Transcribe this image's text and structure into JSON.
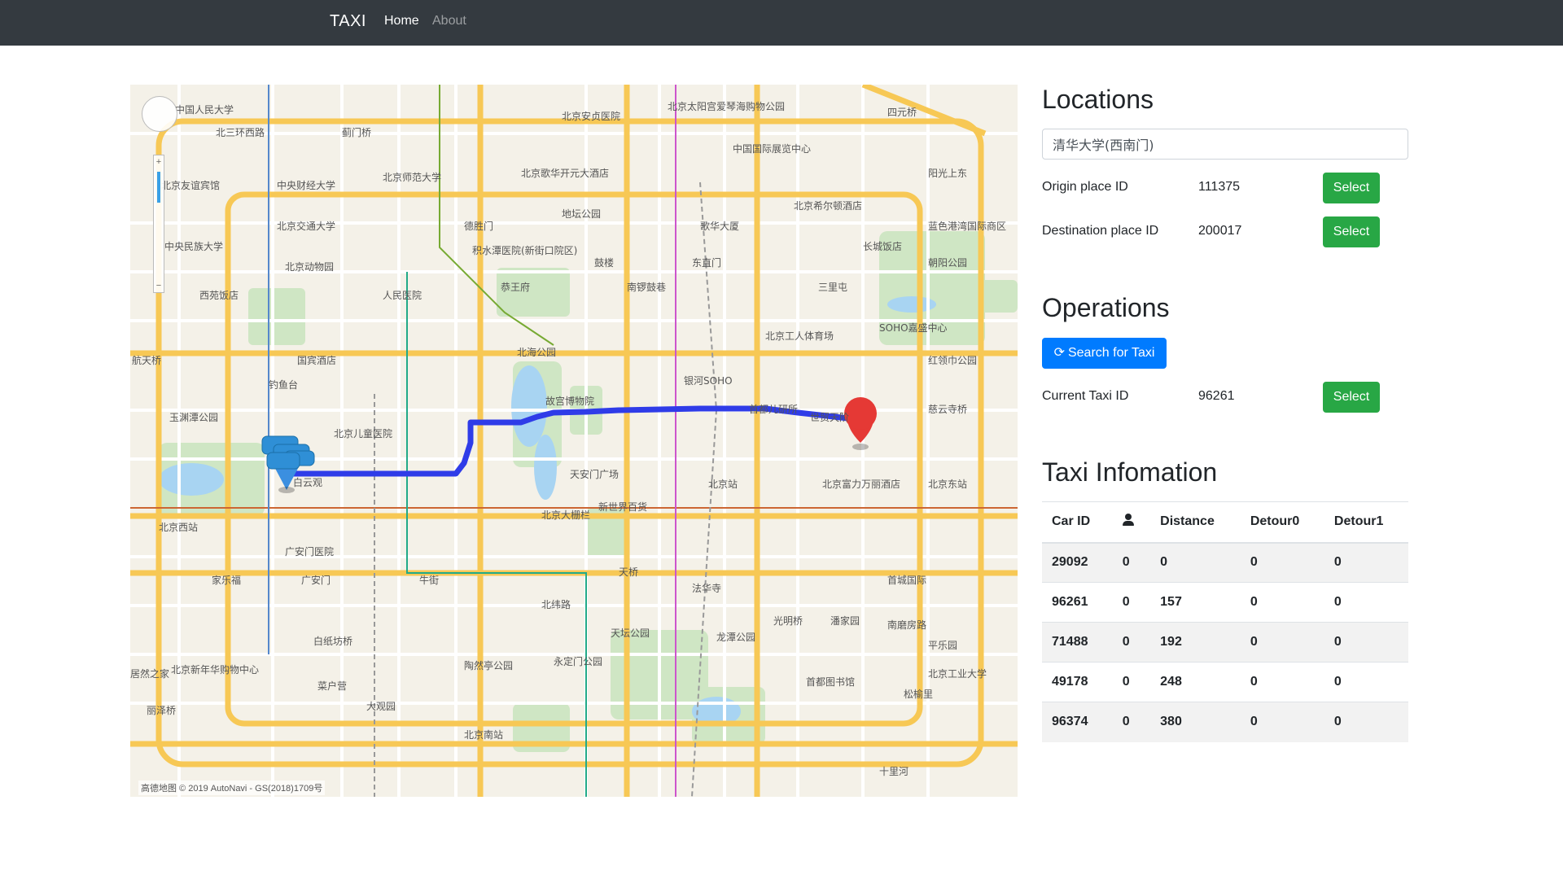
{
  "navbar": {
    "brand": "TAXI",
    "links": [
      "Home",
      "About"
    ]
  },
  "map": {
    "attribution": "高德地图 © 2019 AutoNavi - GS(2018)1709号",
    "labels": [
      "中国人民大学",
      "北三环西路",
      "蓟门桥",
      "北京安贞医院",
      "北京太阳宫爱琴海购物公园",
      "四元桥",
      "北京友谊宾馆",
      "中央财经大学",
      "北京师范大学",
      "北京歌华开元大酒店",
      "中国国际展览中心",
      "阳光上东",
      "北京交通大学",
      "中央民族大学",
      "德胜门",
      "地坛公园",
      "歌华大厦",
      "北京希尔顿酒店",
      "蓝色港湾国际商区",
      "北京动物园",
      "积水潭医院(新街口院区)",
      "鼓楼",
      "南锣鼓巷",
      "东直门",
      "长城饭店",
      "朝阳公园",
      "西苑饭店",
      "人民医院",
      "恭王府",
      "三里屯",
      "北海公园",
      "北京工人体育场",
      "SOHO嘉盛中心",
      "航天桥",
      "国宾酒店",
      "银河SOHO",
      "红领巾公园",
      "钓鱼台",
      "故宫博物院",
      "首都儿研所",
      "世贸天阶",
      "慈云寺桥",
      "玉渊潭公园",
      "北京儿童医院",
      "天安门广场",
      "北京站",
      "北京富力万丽酒店",
      "北京东站",
      "白云观",
      "新世界百货",
      "北京西站",
      "北京大栅栏",
      "广安门医院",
      "天桥",
      "法华寺",
      "首城国际",
      "家乐福",
      "广安门",
      "牛街",
      "北纬路",
      "天坛公园",
      "光明桥",
      "潘家园",
      "平乐园",
      "南磨房路",
      "北京新年华购物中心",
      "白纸坊桥",
      "陶然亭公园",
      "永定门公园",
      "龙潭公园",
      "北京工业大学",
      "居然之家",
      "菜户营",
      "大观园",
      "首都图书馆",
      "松榆里",
      "丽泽桥",
      "北京南站",
      "十里河"
    ]
  },
  "locations": {
    "title": "Locations",
    "input_value": "清华大学(西南门)",
    "origin_label": "Origin place ID",
    "origin_value": "111375",
    "destination_label": "Destination place ID",
    "destination_value": "200017",
    "select_label": "Select"
  },
  "operations": {
    "title": "Operations",
    "search_label": "Search for Taxi",
    "current_label": "Current Taxi ID",
    "current_value": "96261",
    "select_label": "Select"
  },
  "taxi_info": {
    "title": "Taxi Infomation",
    "columns": [
      "Car ID",
      "person-icon",
      "Distance",
      "Detour0",
      "Detour1"
    ],
    "rows": [
      [
        "29092",
        "0",
        "0",
        "0",
        "0"
      ],
      [
        "96261",
        "0",
        "157",
        "0",
        "0"
      ],
      [
        "71488",
        "0",
        "192",
        "0",
        "0"
      ],
      [
        "49178",
        "0",
        "248",
        "0",
        "0"
      ],
      [
        "96374",
        "0",
        "380",
        "0",
        "0"
      ]
    ]
  },
  "colors": {
    "navbar_bg": "#343a40",
    "success": "#28a745",
    "primary": "#007bff",
    "route": "#2f3ce8",
    "origin_marker": "#3b8fe0",
    "destination_marker": "#e53935"
  }
}
